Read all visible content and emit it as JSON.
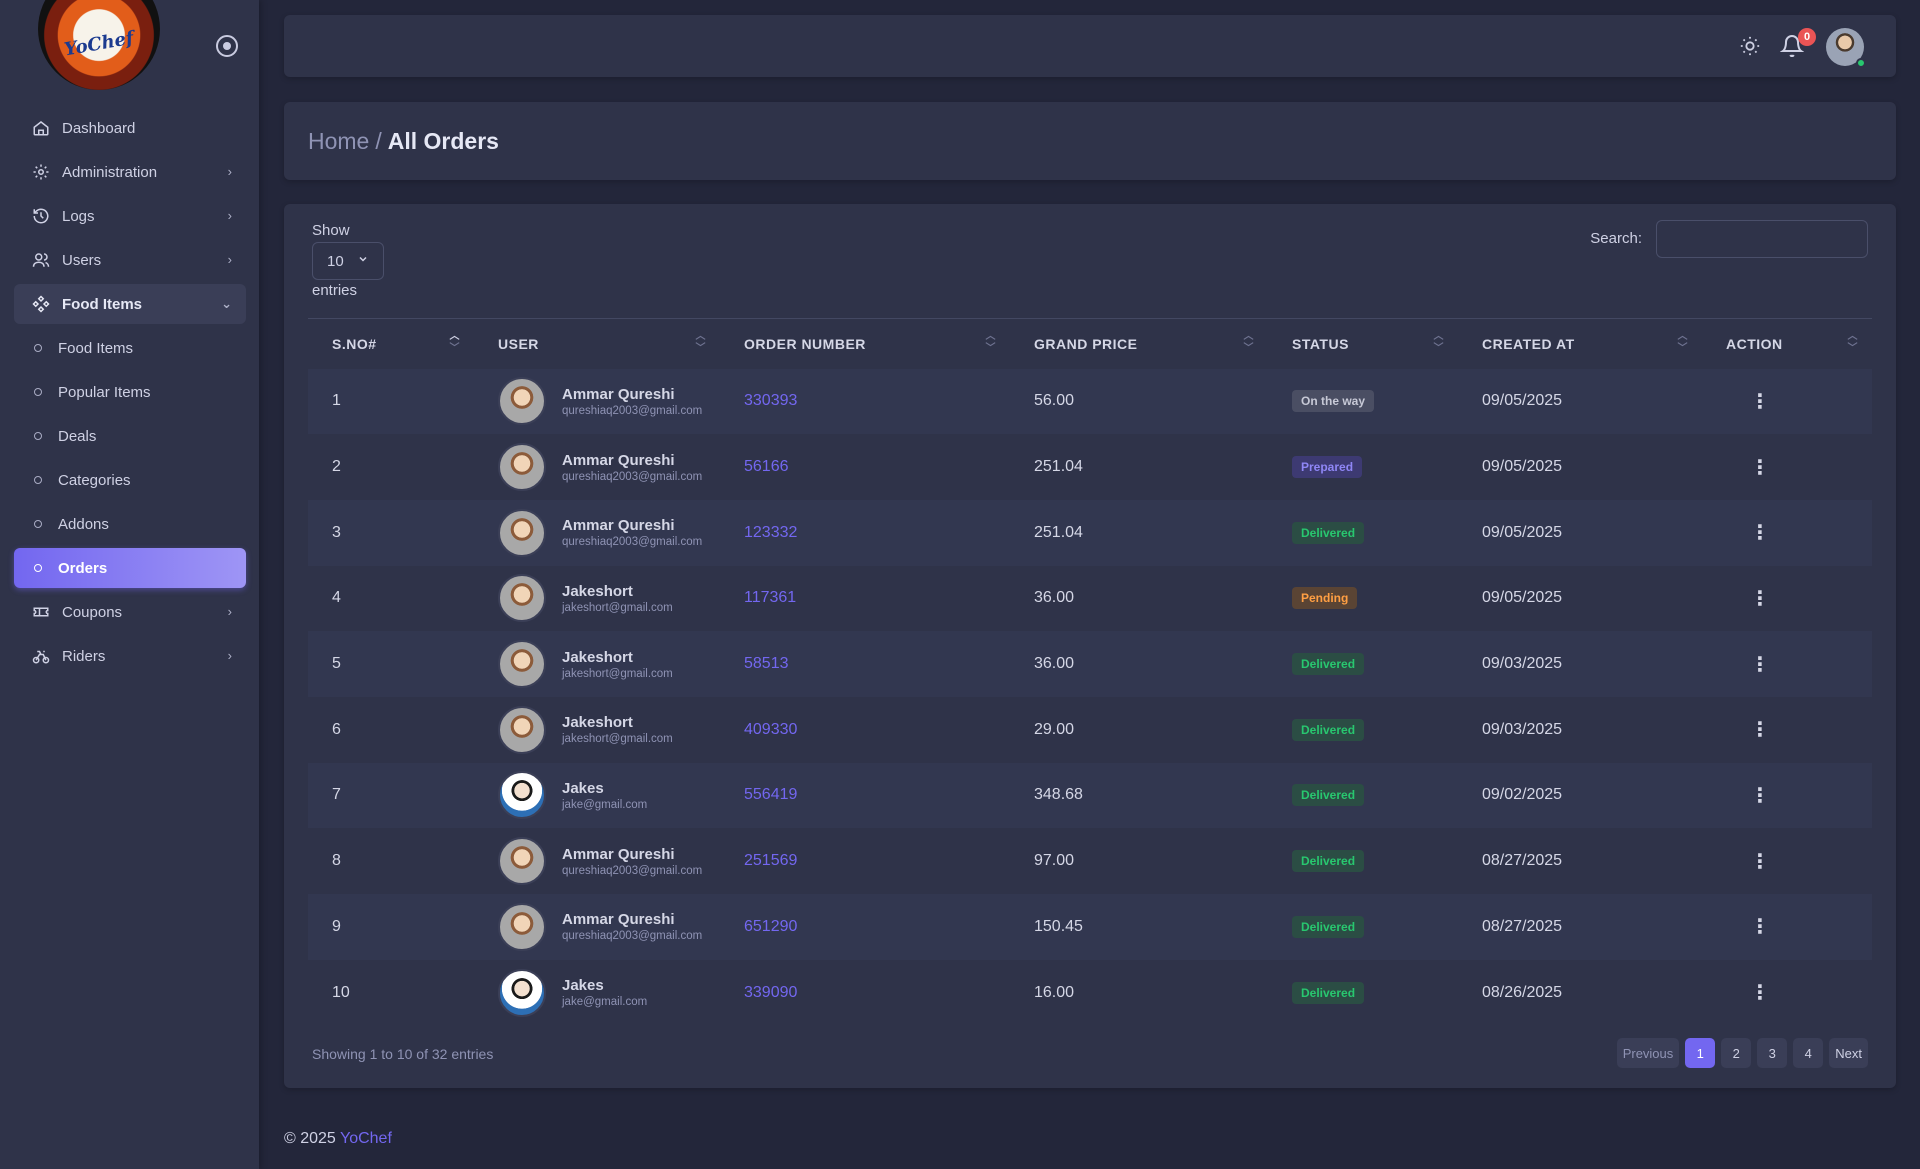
{
  "brand": {
    "logo_text": "YoChef"
  },
  "sidebar": {
    "items": [
      {
        "label": "Dashboard",
        "icon": "home-icon",
        "chevron": ""
      },
      {
        "label": "Administration",
        "icon": "gear-icon",
        "chevron": "›"
      },
      {
        "label": "Logs",
        "icon": "history-icon",
        "chevron": "›"
      },
      {
        "label": "Users",
        "icon": "users-icon",
        "chevron": "›"
      },
      {
        "label": "Food Items",
        "icon": "food-items-icon",
        "chevron": "⌄"
      },
      {
        "label": "Coupons",
        "icon": "coupon-icon",
        "chevron": "›"
      },
      {
        "label": "Riders",
        "icon": "bike-icon",
        "chevron": "›"
      }
    ],
    "sub_items": [
      {
        "label": "Food Items"
      },
      {
        "label": "Popular Items"
      },
      {
        "label": "Deals"
      },
      {
        "label": "Categories"
      },
      {
        "label": "Addons"
      },
      {
        "label": "Orders"
      }
    ]
  },
  "topbar": {
    "notification_count": "0"
  },
  "breadcrumb": {
    "home": "Home",
    "separator": "/",
    "current": "All Orders"
  },
  "table_controls": {
    "show_label": "Show",
    "page_length": "10",
    "entries_label": "entries",
    "search_label": "Search:",
    "search_placeholder": ""
  },
  "table": {
    "columns": [
      "S.NO#",
      "USER",
      "ORDER NUMBER",
      "GRAND PRICE",
      "STATUS",
      "CREATED AT",
      "ACTION"
    ],
    "rows": [
      {
        "sno": "1",
        "name": "Ammar Qureshi",
        "email": "qureshiaq2003@gmail.com",
        "order": "330393",
        "price": "56.00",
        "status": "On the way",
        "date": "09/05/2025",
        "avatar": "male-avatar"
      },
      {
        "sno": "2",
        "name": "Ammar Qureshi",
        "email": "qureshiaq2003@gmail.com",
        "order": "56166",
        "price": "251.04",
        "status": "Prepared",
        "date": "09/05/2025",
        "avatar": "male-avatar"
      },
      {
        "sno": "3",
        "name": "Ammar Qureshi",
        "email": "qureshiaq2003@gmail.com",
        "order": "123332",
        "price": "251.04",
        "status": "Delivered",
        "date": "09/05/2025",
        "avatar": "male-avatar"
      },
      {
        "sno": "4",
        "name": "Jakeshort",
        "email": "jakeshort@gmail.com",
        "order": "117361",
        "price": "36.00",
        "status": "Pending",
        "date": "09/05/2025",
        "avatar": "male-avatar"
      },
      {
        "sno": "5",
        "name": "Jakeshort",
        "email": "jakeshort@gmail.com",
        "order": "58513",
        "price": "36.00",
        "status": "Delivered",
        "date": "09/03/2025",
        "avatar": "male-avatar"
      },
      {
        "sno": "6",
        "name": "Jakeshort",
        "email": "jakeshort@gmail.com",
        "order": "409330",
        "price": "29.00",
        "status": "Delivered",
        "date": "09/03/2025",
        "avatar": "male-avatar"
      },
      {
        "sno": "7",
        "name": "Jakes",
        "email": "jake@gmail.com",
        "order": "556419",
        "price": "348.68",
        "status": "Delivered",
        "date": "09/02/2025",
        "avatar": "suit-avatar"
      },
      {
        "sno": "8",
        "name": "Ammar Qureshi",
        "email": "qureshiaq2003@gmail.com",
        "order": "251569",
        "price": "97.00",
        "status": "Delivered",
        "date": "08/27/2025",
        "avatar": "male-avatar"
      },
      {
        "sno": "9",
        "name": "Ammar Qureshi",
        "email": "qureshiaq2003@gmail.com",
        "order": "651290",
        "price": "150.45",
        "status": "Delivered",
        "date": "08/27/2025",
        "avatar": "male-avatar"
      },
      {
        "sno": "10",
        "name": "Jakes",
        "email": "jake@gmail.com",
        "order": "339090",
        "price": "16.00",
        "status": "Delivered",
        "date": "08/26/2025",
        "avatar": "suit-avatar"
      }
    ]
  },
  "status_colors": {
    "On the way": {
      "bg": "#4a4e63",
      "fg": "#c7c9d6"
    },
    "Prepared": {
      "bg": "#3d3a72",
      "fg": "#8f86f5"
    },
    "Delivered": {
      "bg": "#2b4d44",
      "fg": "#28c76f"
    },
    "Pending": {
      "bg": "#5a4434",
      "fg": "#ff9f43"
    }
  },
  "table_info": "Showing 1 to 10 of 32 entries",
  "pagination": {
    "previous": "Previous",
    "pages": [
      "1",
      "2",
      "3",
      "4"
    ],
    "active": "1",
    "next": "Next"
  },
  "footer": {
    "copyright": "© 2025",
    "brand": "YoChef"
  },
  "colors": {
    "accent": "#7367f0",
    "sidebar_bg": "#2f3349",
    "body_bg": "#23263a"
  }
}
